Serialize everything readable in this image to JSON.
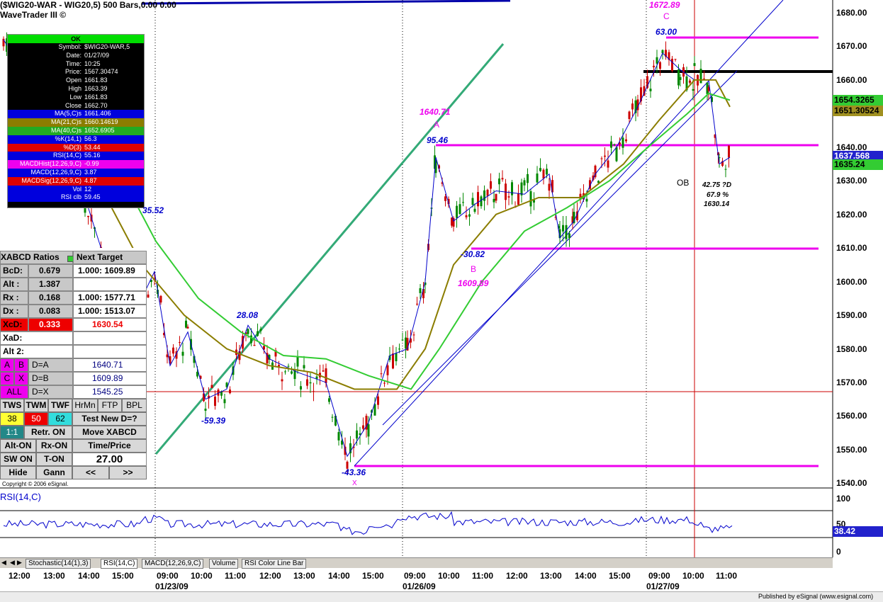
{
  "window": {
    "title": "($WIG20-WAR - WIG20,5) 500 Bars,0.00 0.00",
    "subtitle": "WaveTrader III ©",
    "copyright": "Copyright © 2006 eSignal.",
    "publisher": "Published by eSignal (www.esignal.com)"
  },
  "data_window": {
    "ok_label": "OK",
    "rows": [
      {
        "label": "Symbol:",
        "value": "$WIG20-WAR,5",
        "bg": "#000000",
        "fg": "#ffffff"
      },
      {
        "label": "Date:",
        "value": "01/27/09",
        "bg": "#000000",
        "fg": "#ffffff"
      },
      {
        "label": "Time:",
        "value": "10:25",
        "bg": "#000000",
        "fg": "#ffffff"
      },
      {
        "label": "Price:",
        "value": "1567.30474",
        "bg": "#000000",
        "fg": "#ffffff"
      },
      {
        "label": "Open",
        "value": "1661.83",
        "bg": "#000000",
        "fg": "#ffffff"
      },
      {
        "label": "High",
        "value": "1663.39",
        "bg": "#000000",
        "fg": "#ffffff"
      },
      {
        "label": "Low",
        "value": "1661.83",
        "bg": "#000000",
        "fg": "#ffffff"
      },
      {
        "label": "Close",
        "value": "1662.70",
        "bg": "#000000",
        "fg": "#ffffff"
      },
      {
        "label": "MA(5,C)s",
        "value": "1661.406",
        "bg": "#0000dd",
        "fg": "#ffffff"
      },
      {
        "label": "MA(21,C)s",
        "value": "1660.14619",
        "bg": "#8b7d00",
        "fg": "#ffffff"
      },
      {
        "label": "MA(40,C)s",
        "value": "1652.6905",
        "bg": "#22aa22",
        "fg": "#ffffff"
      },
      {
        "label": "%K(14,1)",
        "value": "56.3",
        "bg": "#0000dd",
        "fg": "#ffffff"
      },
      {
        "label": "%D(3)",
        "value": "53.44",
        "bg": "#dd0000",
        "fg": "#ffffff"
      },
      {
        "label": "RSI(14,C)",
        "value": "55.16",
        "bg": "#0000dd",
        "fg": "#ffffff"
      },
      {
        "label": "MACDHist(12,26,9,C)",
        "value": "-0.99",
        "bg": "#ee00ee",
        "fg": "#ffffff"
      },
      {
        "label": "MACD(12,26,9,C)",
        "value": "3.87",
        "bg": "#0000dd",
        "fg": "#ffffff"
      },
      {
        "label": "MACDSig(12,26,9,C)",
        "value": "4.87",
        "bg": "#dd0000",
        "fg": "#ffffff"
      },
      {
        "label": "Vol",
        "value": "12",
        "bg": "#0000dd",
        "fg": "#ffffff"
      },
      {
        "label": "RSI clb",
        "value": "59.45",
        "bg": "#0000dd",
        "fg": "#ffffff"
      }
    ]
  },
  "ratios": {
    "header": "XABCD Ratios",
    "next_target": "Next Target",
    "bcd_label": "BcD:",
    "bcd_value": "0.679",
    "bcd_target": "1.000: 1609.89",
    "alt_label": "Alt :",
    "alt_value": "1.387",
    "rx_label": "Rx  :",
    "rx_value": "0.168",
    "rx_target": "1.000: 1577.71",
    "dx_label": "Dx  :",
    "dx_value": "0.083",
    "dx_target": "1.000: 1513.07",
    "xcd_label": "XcD:",
    "xcd_value": "0.333",
    "xcd_target": "1630.54",
    "xad_label": "XaD:",
    "alt2_label": "Alt 2:",
    "a_btn": "A",
    "b_btn": "B",
    "da_label": "D=A",
    "da_value": "1640.71",
    "c_btn": "C",
    "x_btn": "X",
    "db_label": "D=B",
    "db_value": "1609.89",
    "all_btn": "ALL",
    "dx2_label": "D=X",
    "dx2_value": "1545.25"
  },
  "controls": {
    "tws": "TWS",
    "twm": "TWM",
    "twf": "TWF",
    "hrmn": "HrMn",
    "ftp": "FTP",
    "bpl": "BPL",
    "v38": "38",
    "v50": "50",
    "v62": "62",
    "test_new": "Test New D=?",
    "one_one": "1:1",
    "retr_on": "Retr. ON",
    "move_xabcd": "Move XABCD",
    "alt_on": "Alt-ON",
    "rx_on": "Rx-ON",
    "time_price": "Time/Price",
    "sw_on": "SW ON",
    "t_on": "T-ON",
    "price_value": "27.00",
    "hide": "Hide",
    "gann": "Gann",
    "prev": "<<",
    "next": ">>"
  },
  "price_axis": {
    "ticks": [
      "1680.00",
      "1670.00",
      "1660.00",
      "1650.00",
      "1640.00",
      "1630.00",
      "1620.00",
      "1610.00",
      "1600.00",
      "1590.00",
      "1580.00",
      "1570.00",
      "1560.00",
      "1550.00",
      "1540.00"
    ],
    "boxes": [
      {
        "label": "1654.3265",
        "bg": "#33cc33"
      },
      {
        "label": "1651.30524",
        "bg": "#a09020"
      },
      {
        "label": "1637.568",
        "bg": "#2222cc"
      },
      {
        "label": "1635.24",
        "bg": "#33cc33"
      }
    ]
  },
  "rsi_panel": {
    "title": "RSI(14,C)",
    "ticks": [
      "100",
      "50",
      "0"
    ],
    "value_box": "38.42"
  },
  "time_axis": {
    "times": [
      "12:00",
      "13:00",
      "14:00",
      "15:00",
      "09:00",
      "10:00",
      "11:00",
      "12:00",
      "13:00",
      "14:00",
      "15:00",
      "09:00",
      "10:00",
      "11:00",
      "12:00",
      "13:00",
      "14:00",
      "15:00",
      "09:00",
      "10:00",
      "11:00"
    ],
    "dates": [
      "01/23/09",
      "01/26/09",
      "01/27/09"
    ]
  },
  "tabs": [
    "Stochastic(14(1),3)",
    "RSI(14,C)",
    "MACD(12,26,9,C)",
    "Volume",
    "RSI Color Line Bar"
  ],
  "annotations": {
    "a_price": "1640.71",
    "a_label": "A",
    "b_price": "1609.89",
    "b_label": "B",
    "c_price": "1672.89",
    "c_label": "C",
    "x_label": "X",
    "v_95_46": "95.46",
    "v_63_00": "63.00",
    "v_35_52": "35.52",
    "v_28_08": "28.08",
    "v_m59_39": "-59.39",
    "v_m30_82": "-30.82",
    "v_m43_36": "-43.36",
    "ob": "OB",
    "d_line1": "42.75 ?D",
    "d_line2": "67.9 %",
    "d_line3": "1630.14"
  },
  "colors": {
    "magenta": "#ee00ee",
    "blue": "#0000cc",
    "olive": "#8b7d00",
    "green": "#33cc33",
    "teal": "#33aa77",
    "red": "#cc0000"
  }
}
